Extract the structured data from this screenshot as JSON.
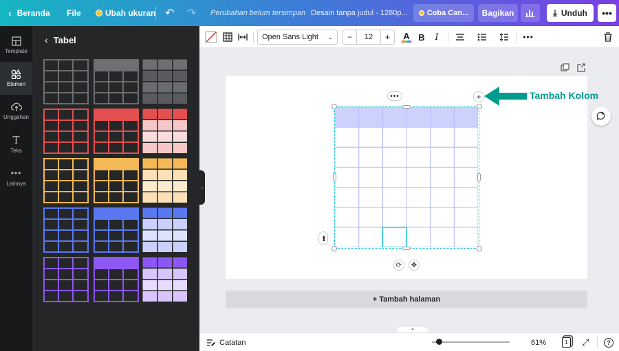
{
  "topbar": {
    "home_label": "Beranda",
    "file_label": "File",
    "resize_label": "Ubah ukuran",
    "save_status": "Perubahan belum tersimpan",
    "doc_title": "Desain tanpa judul - 1280p...",
    "try_label": "Coba Can...",
    "share_label": "Bagikan",
    "download_label": "Unduh",
    "more_label": "•••"
  },
  "rail": {
    "items": [
      {
        "label": "Template",
        "icon": "template-icon"
      },
      {
        "label": "Elemen",
        "icon": "elements-icon"
      },
      {
        "label": "Unggahan",
        "icon": "upload-icon"
      },
      {
        "label": "Teks",
        "icon": "text-icon"
      },
      {
        "label": "Lainnya",
        "icon": "more-icon"
      }
    ]
  },
  "panel": {
    "title": "Tabel",
    "color_rows": [
      {
        "name": "gray",
        "line": "#6b6d70",
        "header": "#6e6f72",
        "cell": "#5a5b5e",
        "cell_alt": "#6b6c6f"
      },
      {
        "name": "red",
        "line": "#e4504f",
        "header": "#e4504f",
        "cell": "#f5c7c7",
        "cell_alt": "#f9dcdc"
      },
      {
        "name": "orange",
        "line": "#f4b856",
        "header": "#f4b856",
        "cell": "#fde0b6",
        "cell_alt": "#fdebd0"
      },
      {
        "name": "blue",
        "line": "#5a78f0",
        "header": "#5a78f0",
        "cell": "#c9d1fb",
        "cell_alt": "#dde3fd"
      },
      {
        "name": "purple",
        "line": "#8c57f2",
        "header": "#8c57f2",
        "cell": "#d7c5fb",
        "cell_alt": "#e6dafd"
      }
    ]
  },
  "editor_toolbar": {
    "font_name": "Open Sans Light",
    "font_size": "12",
    "minus_label": "−",
    "plus_label": "+",
    "bold_label": "B",
    "italic_label": "I"
  },
  "canvas": {
    "add_page_label": "+ Tambah halaman",
    "table": {
      "rows": 7,
      "cols": 6,
      "header_color": "#cdd2fc",
      "line_color": "#b8bff8",
      "selected_cell_color": "#19c5d8"
    }
  },
  "annotation": {
    "label": "Tambah Kolom",
    "color": "#009b8e"
  },
  "bottombar": {
    "notes_label": "Catatan",
    "zoom_label": "61%",
    "page_count": "1",
    "help_label": "?"
  }
}
